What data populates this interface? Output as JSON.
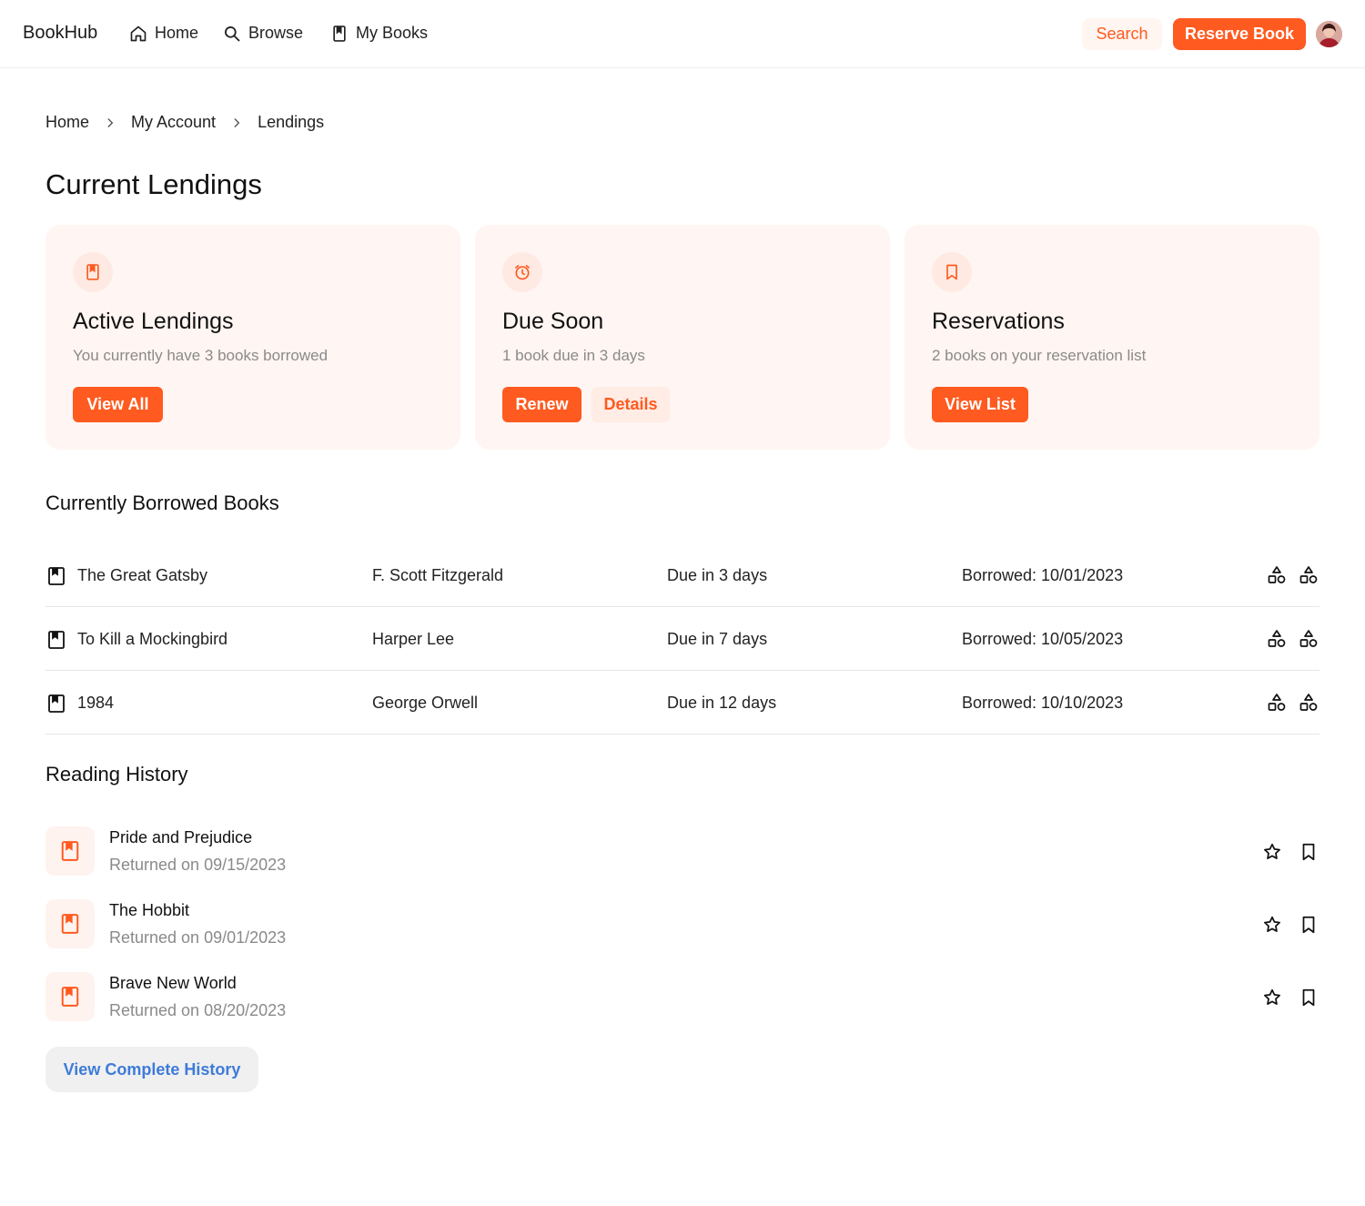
{
  "nav": {
    "brand": "BookHub",
    "links": [
      {
        "label": "Home",
        "icon": "home-icon"
      },
      {
        "label": "Browse",
        "icon": "search-icon"
      },
      {
        "label": "My Books",
        "icon": "book-icon"
      }
    ],
    "search_label": "Search",
    "reserve_label": "Reserve Book",
    "accent": "#ff5a1f"
  },
  "breadcrumb": [
    "Home",
    "My Account",
    "Lendings"
  ],
  "page_title": "Current Lendings",
  "cards": [
    {
      "icon": "book-icon",
      "title": "Active Lendings",
      "subtitle": "You currently have 3 books borrowed",
      "primary": "View All"
    },
    {
      "icon": "alarm-clock-icon",
      "title": "Due Soon",
      "subtitle": "1 book due in 3 days",
      "primary": "Renew",
      "secondary": "Details"
    },
    {
      "icon": "bookmark-icon",
      "title": "Reservations",
      "subtitle": "2 books on your reservation list",
      "primary": "View List"
    }
  ],
  "borrowed": {
    "title": "Currently Borrowed Books",
    "rows": [
      {
        "title": "The Great Gatsby",
        "author": "F. Scott Fitzgerald",
        "due": "Due in 3 days",
        "borrowed": "Borrowed: 10/01/2023"
      },
      {
        "title": "To Kill a Mockingbird",
        "author": "Harper Lee",
        "due": "Due in 7 days",
        "borrowed": "Borrowed: 10/05/2023"
      },
      {
        "title": "1984",
        "author": "George Orwell",
        "due": "Due in 12 days",
        "borrowed": "Borrowed: 10/10/2023"
      }
    ]
  },
  "history": {
    "title": "Reading History",
    "rows": [
      {
        "title": "Pride and Prejudice",
        "returned": "Returned on 09/15/2023"
      },
      {
        "title": "The Hobbit",
        "returned": "Returned on 09/01/2023"
      },
      {
        "title": "Brave New World",
        "returned": "Returned on 08/20/2023"
      }
    ],
    "button": "View Complete History"
  }
}
